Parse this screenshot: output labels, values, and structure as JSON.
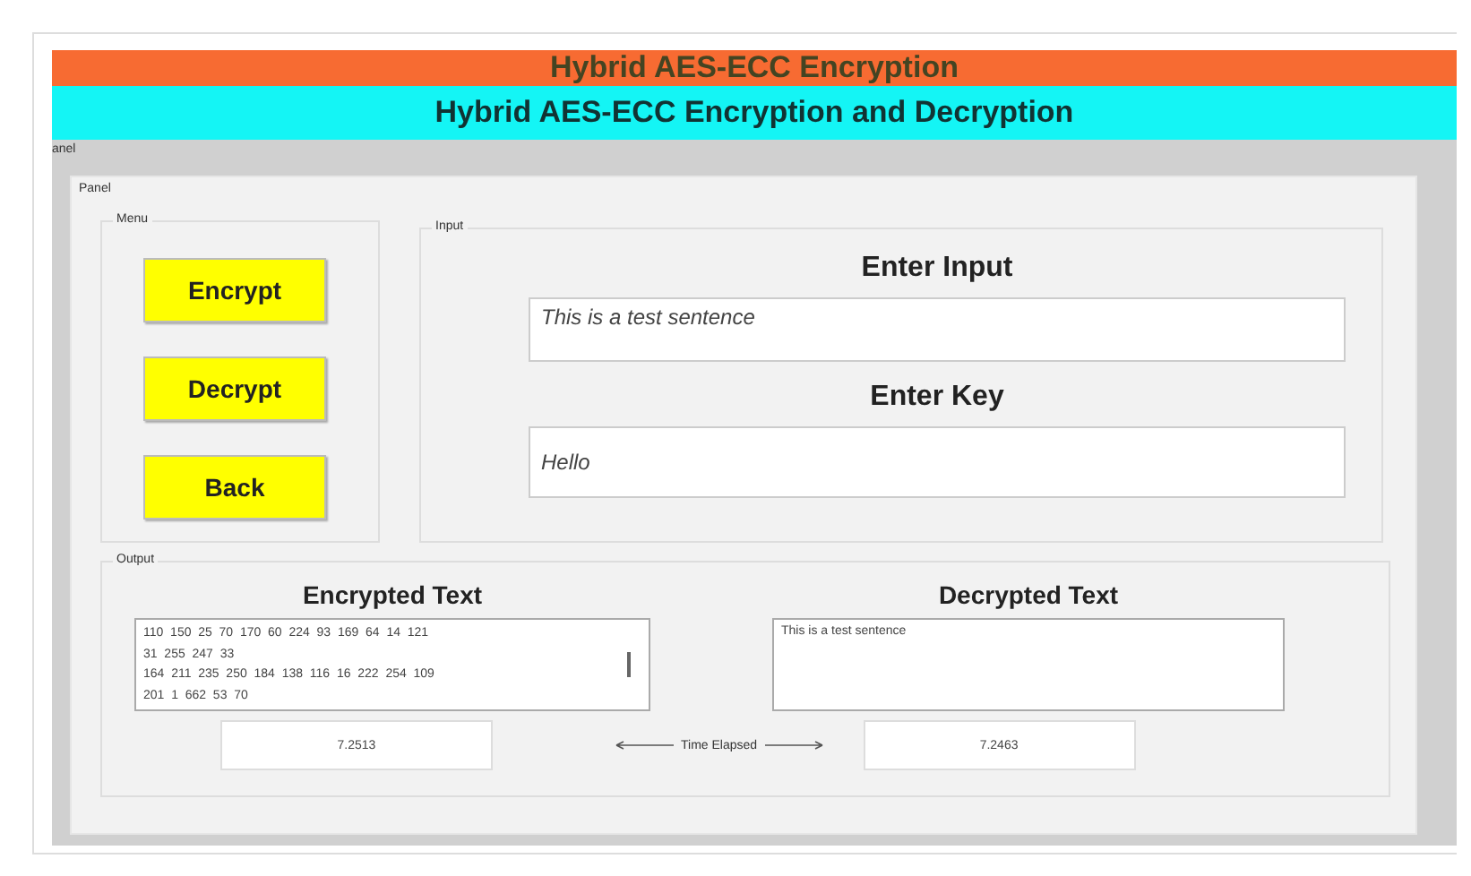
{
  "header": {
    "title": "Hybrid AES-ECC Encryption",
    "subtitle": "Hybrid AES-ECC Encryption and Decryption"
  },
  "outer_panel": {
    "label": "anel"
  },
  "panel": {
    "label": "Panel"
  },
  "menu": {
    "label": "Menu",
    "buttons": [
      "Encrypt",
      "Decrypt",
      "Back"
    ]
  },
  "input": {
    "label": "Input",
    "input_heading": "Enter Input",
    "input_value": "This is a test sentence",
    "key_heading": "Enter Key",
    "key_value": "Hello"
  },
  "output": {
    "label": "Output",
    "encrypted_heading": "Encrypted Text",
    "encrypted_lines": [
      "110  150  25  70  170  60  224  93  169  64  14  121",
      "31  255  247  33",
      "164  211  235  250  184  138  116  16  222  254  109",
      "201  1  662  53  70"
    ],
    "decrypted_heading": "Decrypted Text",
    "decrypted_value": "This is a test sentence",
    "encrypt_time": "7.2513",
    "time_label": "Time Elapsed",
    "decrypt_time": "7.2463"
  }
}
